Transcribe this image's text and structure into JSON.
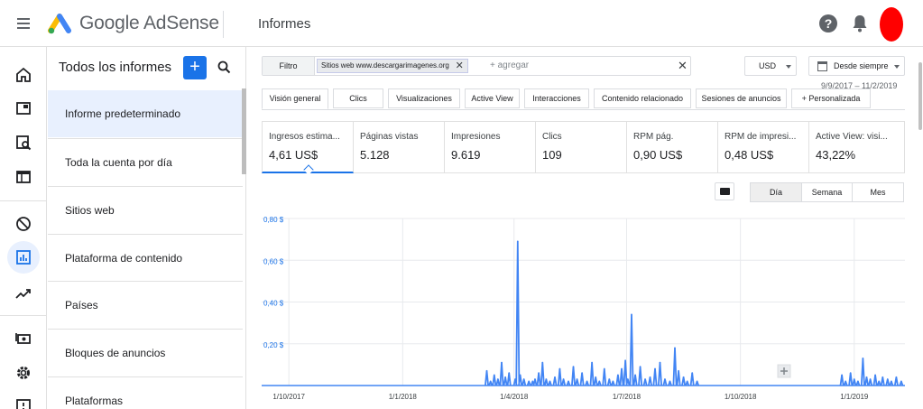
{
  "app": {
    "brand": "Google AdSense",
    "page_title": "Informes"
  },
  "reports_panel": {
    "title": "Todos los informes",
    "add_label": "+",
    "items": [
      {
        "label": "Informe predeterminado",
        "active": true
      },
      {
        "label": "Toda la cuenta por día"
      },
      {
        "label": "Sitios web"
      },
      {
        "label": "Plataforma de contenido"
      },
      {
        "label": "Países"
      },
      {
        "label": "Bloques de anuncios"
      },
      {
        "label": "Plataformas"
      }
    ]
  },
  "filter": {
    "button_label": "Filtro",
    "chip_label": "Sitios web www.descargarimagenes.org",
    "chip_remove": "✕",
    "add_placeholder": "+ agregar",
    "clear": "✕"
  },
  "currency": {
    "value": "USD"
  },
  "date_range": {
    "label": "Desde siempre",
    "range_text": "9/9/2017 – 11/2/2019"
  },
  "tabs": [
    {
      "label": "Visión general",
      "active": true
    },
    {
      "label": "Clics"
    },
    {
      "label": "Visualizaciones"
    },
    {
      "label": "Active View"
    },
    {
      "label": "Interacciones"
    },
    {
      "label": "Contenido relacionado"
    },
    {
      "label": "Sesiones de anuncios"
    },
    {
      "label": "+ Personalizada"
    }
  ],
  "metrics": [
    {
      "label": "Ingresos estima...",
      "value": "4,61 US$",
      "active": true
    },
    {
      "label": "Páginas vistas",
      "value": "5.128"
    },
    {
      "label": "Impresiones",
      "value": "9.619"
    },
    {
      "label": "Clics",
      "value": "109"
    },
    {
      "label": "RPM pág.",
      "value": "0,90 US$"
    },
    {
      "label": "RPM de impresi...",
      "value": "0,48 US$"
    },
    {
      "label": "Active View: visi...",
      "value": "43,22%"
    }
  ],
  "granularity": [
    {
      "label": "Día",
      "active": true
    },
    {
      "label": "Semana"
    },
    {
      "label": "Mes"
    }
  ],
  "icons": {
    "rail": [
      "home-icon",
      "ads-icon",
      "site-search-icon",
      "browser-icon",
      "block-icon",
      "reports-icon",
      "trending-icon",
      "payments-icon",
      "settings-icon",
      "feedback-icon"
    ],
    "header": [
      "menu-icon",
      "adsense-logo-icon",
      "help-icon",
      "bell-icon"
    ]
  },
  "colors": {
    "accent": "#1a73e8",
    "line": "#4285f4",
    "active_bg": "#e8f0fe"
  },
  "chart_data": {
    "type": "line",
    "title": "",
    "xlabel": "",
    "ylabel": "",
    "y_ticks": [
      "0,80 $",
      "0,60 $",
      "0,40 $",
      "0,20 $"
    ],
    "x_ticks": [
      "1/10/2017",
      "1/1/2018",
      "1/4/2018",
      "1/7/2018",
      "1/10/2018",
      "1/1/2019"
    ],
    "ylim": [
      0,
      0.8
    ],
    "xlim": [
      "2017-09-09",
      "2019-02-11"
    ],
    "grid": true,
    "series": [
      {
        "x": [
          "2018-03-10",
          "2018-03-13",
          "2018-03-16",
          "2018-03-19",
          "2018-03-22",
          "2018-03-25",
          "2018-03-28",
          "2018-04-02",
          "2018-04-04",
          "2018-04-06",
          "2018-04-09",
          "2018-04-13",
          "2018-04-16",
          "2018-04-18",
          "2018-04-21",
          "2018-04-24",
          "2018-04-27",
          "2018-04-30",
          "2018-05-04",
          "2018-05-08",
          "2018-05-11",
          "2018-05-15",
          "2018-05-19",
          "2018-05-22",
          "2018-05-26",
          "2018-05-30",
          "2018-06-03",
          "2018-06-06",
          "2018-06-09",
          "2018-06-13",
          "2018-06-17",
          "2018-06-20",
          "2018-06-24",
          "2018-06-27",
          "2018-06-30",
          "2018-07-02",
          "2018-07-05",
          "2018-07-08",
          "2018-07-12",
          "2018-07-16",
          "2018-07-20",
          "2018-07-24",
          "2018-07-28",
          "2018-08-01",
          "2018-08-05",
          "2018-08-09",
          "2018-08-12",
          "2018-08-16",
          "2018-08-19",
          "2018-08-23",
          "2018-08-27",
          "2018-12-22",
          "2018-12-25",
          "2018-12-29",
          "2019-01-01",
          "2019-01-04",
          "2019-01-08",
          "2019-01-11",
          "2019-01-14",
          "2019-01-18",
          "2019-01-21",
          "2019-01-24",
          "2019-01-28",
          "2019-01-31",
          "2019-02-04",
          "2019-02-08"
        ],
        "y": [
          0.07,
          0.02,
          0.05,
          0.03,
          0.11,
          0.04,
          0.06,
          0.03,
          0.69,
          0.05,
          0.03,
          0.02,
          0.02,
          0.03,
          0.06,
          0.11,
          0.03,
          0.02,
          0.04,
          0.08,
          0.03,
          0.02,
          0.09,
          0.03,
          0.06,
          0.02,
          0.11,
          0.04,
          0.02,
          0.08,
          0.03,
          0.02,
          0.05,
          0.08,
          0.12,
          0.03,
          0.34,
          0.05,
          0.09,
          0.03,
          0.04,
          0.08,
          0.11,
          0.03,
          0.02,
          0.18,
          0.07,
          0.04,
          0.02,
          0.06,
          0.02,
          0.05,
          0.02,
          0.06,
          0.03,
          0.02,
          0.13,
          0.04,
          0.03,
          0.05,
          0.02,
          0.04,
          0.03,
          0.02,
          0.04,
          0.02
        ]
      }
    ]
  }
}
